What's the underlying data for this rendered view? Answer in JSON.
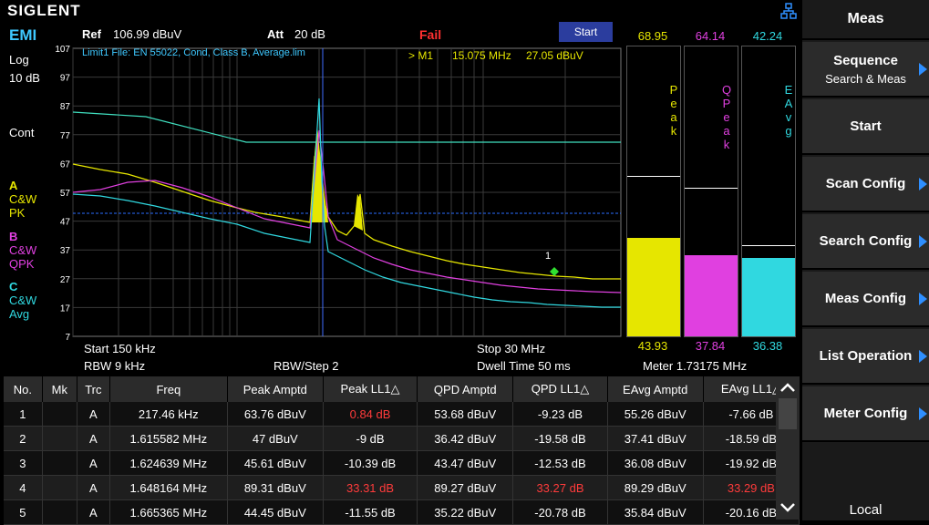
{
  "header": {
    "brand": "SIGLENT",
    "mode": "EMI",
    "ref_label": "Ref",
    "ref_value": "106.99 dBuV",
    "att_label": "Att",
    "att_value": "20 dB",
    "status": "Fail",
    "start_button": "Start"
  },
  "left": {
    "scale": "Log",
    "scale_div": "10 dB",
    "sweep": "Cont",
    "traces": [
      {
        "letter": "A",
        "l1": "C&W",
        "l2": "PK",
        "color": "#e6e600"
      },
      {
        "letter": "B",
        "l1": "C&W",
        "l2": "QPK",
        "color": "#e040e0"
      },
      {
        "letter": "C",
        "l1": "C&W",
        "l2": "Avg",
        "color": "#30d8e0"
      }
    ]
  },
  "plot": {
    "limit_label": "Limit1 File: EN 55022, Cond, Class B, Average.lim",
    "marker_label": ">  M1",
    "marker_freq": "15.075 MHz",
    "marker_ampl": "27.05 dBuV",
    "marker_number": "1",
    "y_ticks": [
      "107",
      "97",
      "87",
      "77",
      "67",
      "57",
      "47",
      "37",
      "27",
      "17",
      "7"
    ]
  },
  "footer": {
    "start": "Start  150 kHz",
    "rbw": "RBW  9 kHz",
    "rbw_step": "RBW/Step    2",
    "stop": "Stop  30 MHz",
    "dwell": "Dwell Time    50 ms",
    "meter": "Meter  1.73175 MHz"
  },
  "meters": [
    {
      "top": "68.95",
      "label": "Peak",
      "bottom": "43.93",
      "color": "#e6e600",
      "fill": 0.34,
      "peak": 0.55
    },
    {
      "top": "64.14",
      "label": "QPeak",
      "bottom": "37.84",
      "color": "#e040e0",
      "fill": 0.28,
      "peak": 0.51
    },
    {
      "top": "42.24",
      "label": "EAvg",
      "bottom": "36.38",
      "color": "#30d8e0",
      "fill": 0.27,
      "peak": 0.31
    }
  ],
  "table": {
    "headers": [
      "No.",
      "Mk",
      "Trc",
      "Freq",
      "Peak Amptd",
      "Peak LL1△",
      "QPD Amptd",
      "QPD LL1△",
      "EAvg Amptd",
      "EAvg LL1△"
    ],
    "rows": [
      [
        "1",
        "",
        "A",
        "217.46 kHz",
        "63.76 dBuV",
        "0.84 dB",
        "53.68 dBuV",
        "-9.23 dB",
        "55.26 dBuV",
        "-7.66 dB"
      ],
      [
        "2",
        "",
        "A",
        "1.615582 MHz",
        "47 dBuV",
        "-9 dB",
        "36.42 dBuV",
        "-19.58 dB",
        "37.41 dBuV",
        "-18.59 dB"
      ],
      [
        "3",
        "",
        "A",
        "1.624639 MHz",
        "45.61 dBuV",
        "-10.39 dB",
        "43.47 dBuV",
        "-12.53 dB",
        "36.08 dBuV",
        "-19.92 dB"
      ],
      [
        "4",
        "",
        "A",
        "1.648164 MHz",
        "89.31 dBuV",
        "33.31 dB",
        "89.27 dBuV",
        "33.27 dB",
        "89.29 dBuV",
        "33.29 dB"
      ],
      [
        "5",
        "",
        "A",
        "1.665365 MHz",
        "44.45 dBuV",
        "-11.55 dB",
        "35.22 dBuV",
        "-20.78 dB",
        "35.84 dBuV",
        "-20.16 dB"
      ]
    ],
    "red_cells": [
      [
        0,
        5
      ],
      [
        3,
        5
      ],
      [
        3,
        7
      ],
      [
        3,
        9
      ]
    ]
  },
  "menu": {
    "title": "Meas",
    "items": [
      {
        "label": "Sequence",
        "sub": "Search & Meas",
        "arrow": true
      },
      {
        "label": "Start",
        "sub": "",
        "arrow": false
      },
      {
        "label": "Scan Config",
        "sub": "",
        "arrow": true
      },
      {
        "label": "Search Config",
        "sub": "",
        "arrow": true
      },
      {
        "label": "Meas Config",
        "sub": "",
        "arrow": true
      },
      {
        "label": "List Operation",
        "sub": "",
        "arrow": true
      },
      {
        "label": "Meter Config",
        "sub": "",
        "arrow": true
      }
    ],
    "footer": "Local"
  }
}
